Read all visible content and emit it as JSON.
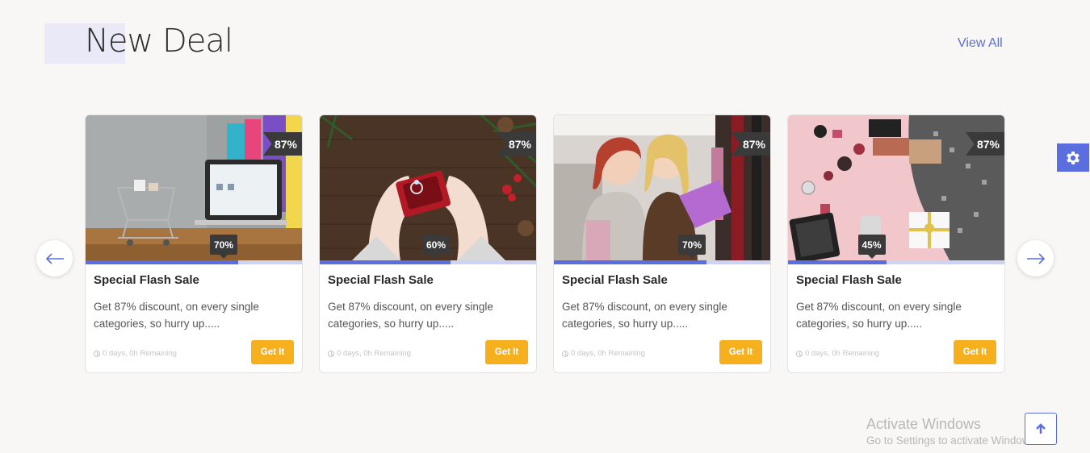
{
  "header": {
    "title": "New Deal",
    "view_all_label": "View All"
  },
  "nav": {
    "prev_icon": "arrow-left-icon",
    "next_icon": "arrow-right-icon"
  },
  "cards": [
    {
      "image": "laptop-shopping-cart-image",
      "discount_badge": "87%",
      "progress_label": "70%",
      "progress": 0.7,
      "title": "Special Flash Sale",
      "description": "Get 87% discount, on every single categories, so hurry up.....",
      "timer": "0 days, 0h Remaining",
      "button_label": "Get It"
    },
    {
      "image": "ring-box-image",
      "discount_badge": "87%",
      "progress_label": "60%",
      "progress": 0.6,
      "title": "Special Flash Sale",
      "description": "Get 87% discount, on every single categories, so hurry up.....",
      "timer": "0 days, 0h Remaining",
      "button_label": "Get It"
    },
    {
      "image": "shopping-women-image",
      "discount_badge": "87%",
      "progress_label": "70%",
      "progress": 0.7,
      "title": "Special Flash Sale",
      "description": "Get 87% discount, on every single categories, so hurry up.....",
      "timer": "0 days, 0h Remaining",
      "button_label": "Get It"
    },
    {
      "image": "cosmetics-flatlay-image",
      "discount_badge": "87%",
      "progress_label": "45%",
      "progress": 0.45,
      "title": "Special Flash Sale",
      "description": "Get 87% discount, on every single categories, so hurry up.....",
      "timer": "0 days, 0h Remaining",
      "button_label": "Get It"
    }
  ],
  "colors": {
    "accent": "#5a6ee0",
    "button": "#f6b01d",
    "badge": "#3a3a3a"
  },
  "watermark": {
    "title": "Activate Windows",
    "subtitle": "Go to Settings to activate Windows."
  },
  "icons": {
    "settings": "gear-icon",
    "scroll_top": "arrow-up-icon",
    "timer": "clock-icon"
  }
}
